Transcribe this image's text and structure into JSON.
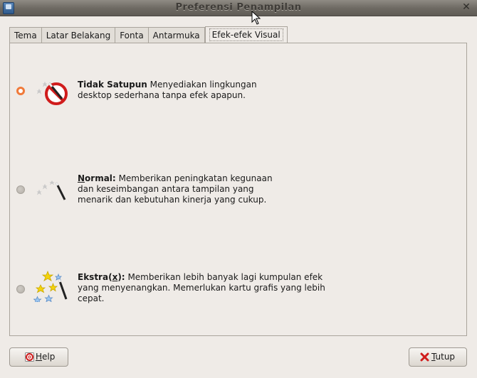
{
  "window": {
    "title": "Preferensi Penampilan"
  },
  "tabs": [
    {
      "label": "Tema",
      "active": false
    },
    {
      "label": "Latar Belakang",
      "active": false
    },
    {
      "label": "Fonta",
      "active": false
    },
    {
      "label": "Antarmuka",
      "active": false
    },
    {
      "label": "Efek-efek Visual",
      "active": true
    }
  ],
  "options": [
    {
      "title": "Tidak Satupun",
      "selected": true,
      "icon": "no-effects-wand-icon",
      "lines": [
        "Menyediakan lingkungan",
        "desktop sederhana tanpa efek apapun."
      ]
    },
    {
      "title": "Normal:",
      "mnemonic": "N",
      "selected": false,
      "icon": "magic-wand-icon",
      "lines": [
        "Memberikan peningkatan kegunaan",
        "dan keseimbangan antara tampilan yang",
        "menarik dan kebutuhan kinerja yang cukup."
      ]
    },
    {
      "title": "Ekstra(x):",
      "mnemonic": "x",
      "selected": false,
      "icon": "magic-wand-stars-icon",
      "lines": [
        "Memberikan lebih banyak lagi kumpulan efek",
        "yang menyenangkan. Memerlukan kartu grafis yang lebih",
        "cepat."
      ]
    }
  ],
  "buttons": {
    "help": {
      "label": "Help",
      "mnemonic": "H",
      "icon": "help-lifebuoy-icon"
    },
    "close": {
      "label": "Tutup",
      "mnemonic": "T",
      "icon": "close-x-icon"
    }
  },
  "colors": {
    "accent_radio": "#f07a3a",
    "close_red": "#d01c1c"
  }
}
